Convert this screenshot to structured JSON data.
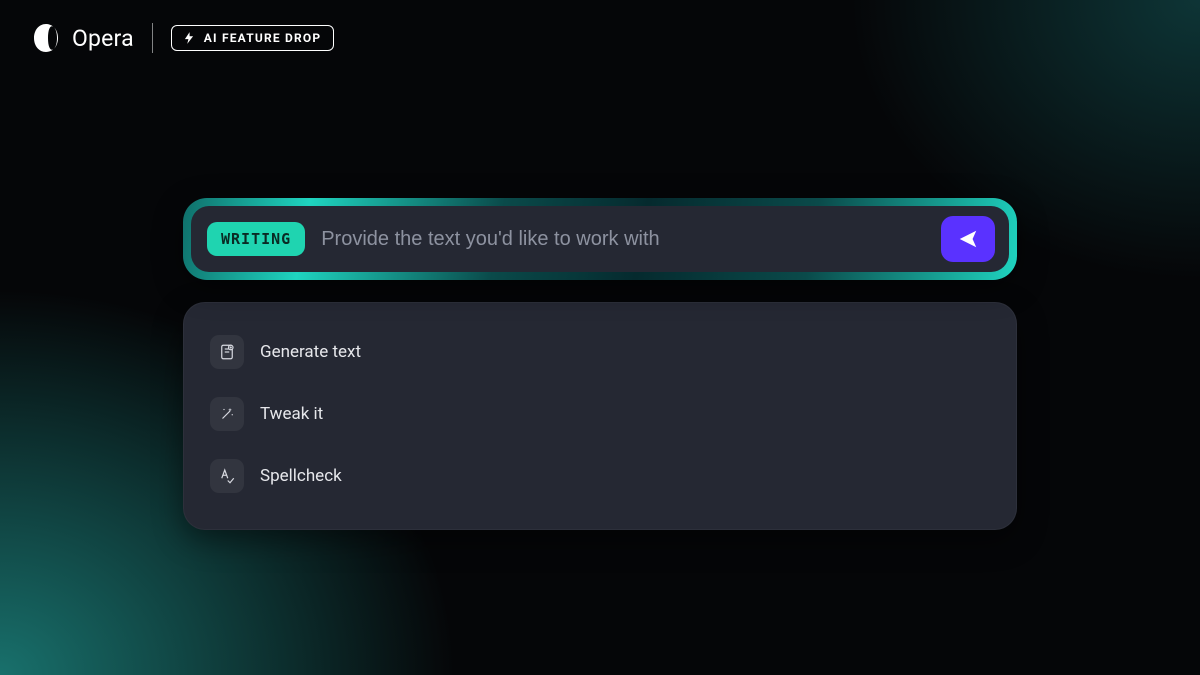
{
  "header": {
    "brand_name": "Opera",
    "feature_badge": "AI FEATURE DROP"
  },
  "prompt": {
    "mode_label": "WRITING",
    "placeholder": "Provide the text you'd like to work with"
  },
  "options": [
    {
      "icon": "document-plus-icon",
      "label": "Generate text"
    },
    {
      "icon": "magic-wand-icon",
      "label": "Tweak it"
    },
    {
      "icon": "spellcheck-icon",
      "label": "Spellcheck"
    }
  ]
}
